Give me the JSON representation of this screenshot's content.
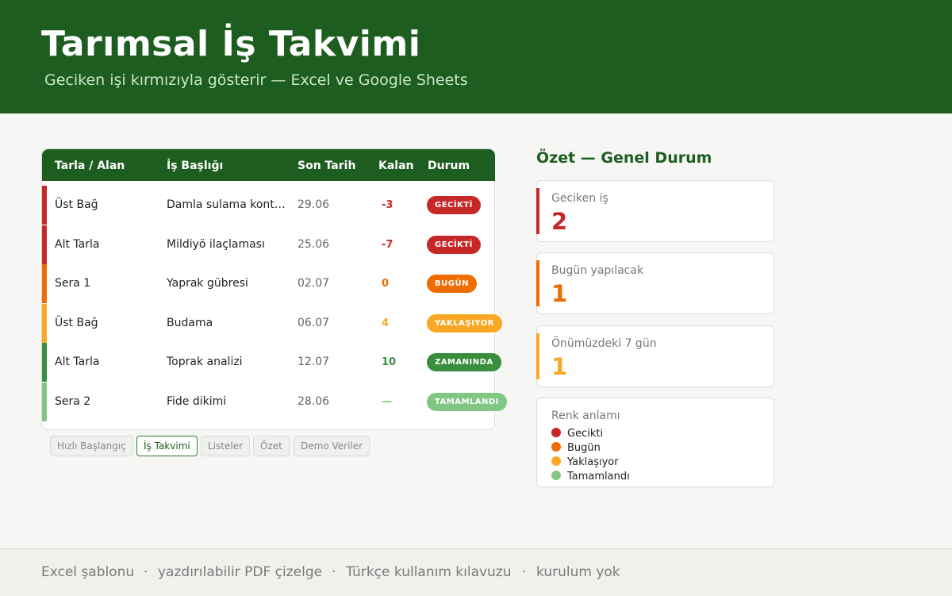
{
  "header": {
    "title": "Tarımsal İş Takvimi",
    "subtitle": "Geciken işi kırmızıyla gösterir — Excel ve Google Sheets"
  },
  "table": {
    "columns": [
      "Tarla / Alan",
      "İş Başlığı",
      "Son Tarih",
      "Kalan",
      "Durum"
    ],
    "rows": [
      {
        "alan": "Üst Bağ",
        "is": "Damla sulama kont…",
        "tarih": "29.06",
        "kalan": "-3",
        "durum": "GECİKTİ",
        "color": "#c62828"
      },
      {
        "alan": "Alt Tarla",
        "is": "Mildiyö ilaçlaması",
        "tarih": "25.06",
        "kalan": "-7",
        "durum": "GECİKTİ",
        "color": "#c62828"
      },
      {
        "alan": "Sera 1",
        "is": "Yaprak gübresi",
        "tarih": "02.07",
        "kalan": "0",
        "durum": "BUGÜN",
        "color": "#ef6c00"
      },
      {
        "alan": "Üst Bağ",
        "is": "Budama",
        "tarih": "06.07",
        "kalan": "4",
        "durum": "YAKLAŞIYOR",
        "color": "#f9a825"
      },
      {
        "alan": "Alt Tarla",
        "is": "Toprak analizi",
        "tarih": "12.07",
        "kalan": "10",
        "durum": "ZAMANINDA",
        "color": "#388e3c"
      },
      {
        "alan": "Sera 2",
        "is": "Fide dikimi",
        "tarih": "28.06",
        "kalan": "—",
        "durum": "TAMAMLANDI",
        "color": "#81c784"
      }
    ]
  },
  "tabs": [
    "Hızlı Başlangıç",
    "İş Takvimi",
    "Listeler",
    "Özet",
    "Demo Veriler"
  ],
  "active_tab": "İş Takvimi",
  "summary": {
    "title": "Özet — Genel Durum",
    "cards": [
      {
        "label": "Geciken iş",
        "value": "2",
        "color": "#c62828"
      },
      {
        "label": "Bugün yapılacak",
        "value": "1",
        "color": "#ef6c00"
      },
      {
        "label": "Önümüzdeki 7 gün",
        "value": "1",
        "color": "#f9a825"
      }
    ],
    "legend": {
      "label": "Renk anlamı",
      "items": [
        {
          "text": "Gecikti",
          "color": "#c62828"
        },
        {
          "text": "Bugün",
          "color": "#ef6c00"
        },
        {
          "text": "Yaklaşıyor",
          "color": "#f9a825"
        },
        {
          "text": "Tamamlandı",
          "color": "#81c784"
        }
      ]
    }
  },
  "footer": {
    "items": [
      "Excel şablonu",
      "yazdırılabilir PDF çizelge",
      "Türkçe kullanım kılavuzu",
      "kurulum yok"
    ],
    "separator": "·"
  }
}
